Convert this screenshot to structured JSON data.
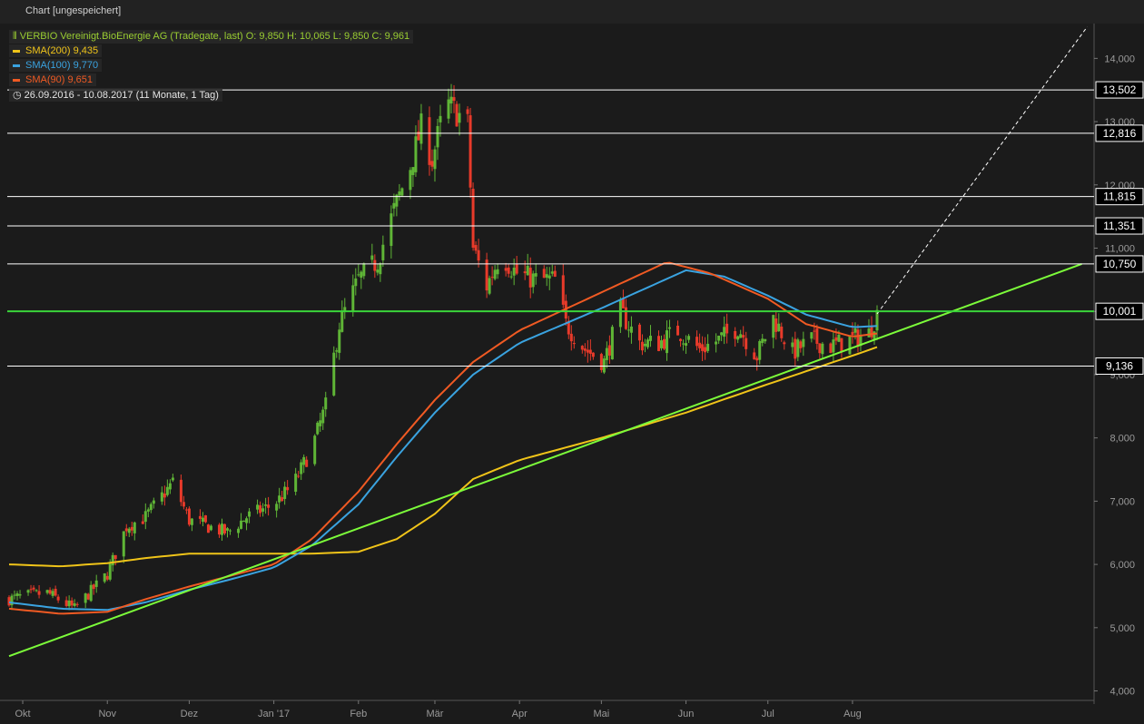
{
  "window": {
    "title": "Chart [ungespeichert]"
  },
  "legend": {
    "main": "VERBIO Vereinigt.BioEnergie AG (Tradegate, last)  O: 9,850  H: 10,065  L: 9,850  C: 9,961",
    "main_color": "#9acd32",
    "sma200": "SMA(200)  9,435",
    "sma100": "SMA(100)  9,770",
    "sma90": "SMA(90)  9,651",
    "range": "26.09.2016 - 10.08.2017   (11 Monate, 1 Tag)",
    "clock_icon": "clock-icon"
  },
  "chart_data": {
    "type": "candlestick",
    "title": "VERBIO Vereinigt.BioEnergie AG (Tradegate, last)",
    "period": "26.09.2016 - 10.08.2017",
    "ylim": [
      3.85,
      14.55
    ],
    "x_labels": [
      "Okt",
      "Nov",
      "Dez",
      "Jan '17",
      "Feb",
      "Mär",
      "Apr",
      "Mai",
      "Jun",
      "Jul",
      "Aug"
    ],
    "y_labels": [
      "4,000",
      "5,000",
      "6,000",
      "7,000",
      "8,000",
      "9,000",
      "10,000",
      "11,000",
      "12,000",
      "13,000",
      "14,000"
    ],
    "y_ticks": [
      4,
      5,
      6,
      7,
      8,
      9,
      10,
      11,
      12,
      13,
      14
    ],
    "colors": {
      "up": "#5fb536",
      "down": "#e83a2a",
      "sma200": "#f0c419",
      "sma100": "#3aa3e0",
      "sma90": "#f05a23",
      "trend": "#7cfc3a",
      "support": "#3ad53a",
      "level": "#ffffff"
    },
    "horizontal_levels": [
      {
        "value": 13.502,
        "label": "13,502",
        "color": "#ffffff"
      },
      {
        "value": 12.816,
        "label": "12,816",
        "color": "#ffffff"
      },
      {
        "value": 11.815,
        "label": "11,815",
        "color": "#ffffff"
      },
      {
        "value": 11.351,
        "label": "11,351",
        "color": "#ffffff"
      },
      {
        "value": 10.75,
        "label": "10,750",
        "color": "#ffffff"
      },
      {
        "value": 10.001,
        "label": "10,001",
        "color": "#3ad53a"
      },
      {
        "value": 9.136,
        "label": "9,136",
        "color": "#ffffff"
      }
    ],
    "trendline": {
      "start": [
        "26.09.2016",
        4.55
      ],
      "end": [
        "10.08.2017",
        9.5
      ],
      "extends_to": [
        "24.10.2017",
        10.75
      ]
    },
    "projection": {
      "start": [
        "10.08.2017",
        9.96
      ],
      "end": [
        "26.10.2017",
        14.5
      ]
    },
    "price_anchors": [
      [
        "26.09.2016",
        5.45
      ],
      [
        "01.10.2016",
        5.5
      ],
      [
        "10.10.2016",
        5.55
      ],
      [
        "20.10.2016",
        5.3
      ],
      [
        "01.11.2016",
        5.85
      ],
      [
        "08.11.2016",
        6.6
      ],
      [
        "15.11.2016",
        6.75
      ],
      [
        "25.11.2016",
        7.3
      ],
      [
        "01.12.2016",
        6.7
      ],
      [
        "08.12.2016",
        6.6
      ],
      [
        "15.12.2016",
        6.5
      ],
      [
        "22.12.2016",
        6.75
      ],
      [
        "01.01.2017",
        6.95
      ],
      [
        "08.01.2017",
        7.25
      ],
      [
        "15.01.2017",
        7.85
      ],
      [
        "20.01.2017",
        8.5
      ],
      [
        "25.01.2017",
        9.8
      ],
      [
        "01.02.2017",
        10.5
      ],
      [
        "08.02.2017",
        10.8
      ],
      [
        "14.02.2017",
        11.6
      ],
      [
        "20.02.2017",
        12.3
      ],
      [
        "24.02.2017",
        12.9
      ],
      [
        "28.02.2017",
        12.4
      ],
      [
        "05.03.2017",
        13.3
      ],
      [
        "10.03.2017",
        13.1
      ],
      [
        "13.03.2017",
        12.95
      ],
      [
        "15.03.2017",
        11.0
      ],
      [
        "20.03.2017",
        10.4
      ],
      [
        "25.03.2017",
        10.9
      ],
      [
        "31.03.2017",
        10.6
      ],
      [
        "07.04.2017",
        10.5
      ],
      [
        "14.04.2017",
        10.5
      ],
      [
        "18.04.2017",
        9.8
      ],
      [
        "25.04.2017",
        9.4
      ],
      [
        "02.05.2017",
        9.2
      ],
      [
        "08.05.2017",
        10.0
      ],
      [
        "15.05.2017",
        9.5
      ],
      [
        "22.05.2017",
        9.5
      ],
      [
        "29.05.2017",
        9.7
      ],
      [
        "06.06.2017",
        9.4
      ],
      [
        "13.06.2017",
        9.55
      ],
      [
        "20.06.2017",
        9.75
      ],
      [
        "27.06.2017",
        9.3
      ],
      [
        "03.07.2017",
        9.9
      ],
      [
        "10.07.2017",
        9.35
      ],
      [
        "17.07.2017",
        9.55
      ],
      [
        "24.07.2017",
        9.45
      ],
      [
        "31.07.2017",
        9.55
      ],
      [
        "07.08.2017",
        9.65
      ],
      [
        "10.08.2017",
        9.96
      ]
    ],
    "sma200_anchors": [
      [
        "26.09.2016",
        6.0
      ],
      [
        "15.10.2016",
        5.97
      ],
      [
        "01.11.2016",
        6.02
      ],
      [
        "15.11.2016",
        6.1
      ],
      [
        "01.12.2016",
        6.17
      ],
      [
        "15.01.2017",
        6.17
      ],
      [
        "01.02.2017",
        6.2
      ],
      [
        "15.02.2017",
        6.4
      ],
      [
        "01.03.2017",
        6.8
      ],
      [
        "15.03.2017",
        7.35
      ],
      [
        "01.04.2017",
        7.65
      ],
      [
        "01.05.2017",
        8.0
      ],
      [
        "01.06.2017",
        8.4
      ],
      [
        "01.07.2017",
        8.85
      ],
      [
        "01.08.2017",
        9.3
      ],
      [
        "10.08.2017",
        9.435
      ]
    ],
    "sma100_anchors": [
      [
        "26.09.2016",
        5.4
      ],
      [
        "15.10.2016",
        5.3
      ],
      [
        "01.11.2016",
        5.28
      ],
      [
        "15.11.2016",
        5.4
      ],
      [
        "01.12.2016",
        5.6
      ],
      [
        "15.12.2016",
        5.75
      ],
      [
        "01.01.2017",
        5.95
      ],
      [
        "15.01.2017",
        6.3
      ],
      [
        "01.02.2017",
        6.95
      ],
      [
        "15.02.2017",
        7.7
      ],
      [
        "01.03.2017",
        8.4
      ],
      [
        "15.03.2017",
        9.0
      ],
      [
        "01.04.2017",
        9.5
      ],
      [
        "01.05.2017",
        10.05
      ],
      [
        "01.06.2017",
        10.65
      ],
      [
        "15.06.2017",
        10.55
      ],
      [
        "01.07.2017",
        10.25
      ],
      [
        "15.07.2017",
        9.95
      ],
      [
        "01.08.2017",
        9.75
      ],
      [
        "10.08.2017",
        9.77
      ]
    ],
    "sma90_anchors": [
      [
        "26.09.2016",
        5.3
      ],
      [
        "15.10.2016",
        5.22
      ],
      [
        "01.11.2016",
        5.25
      ],
      [
        "15.11.2016",
        5.45
      ],
      [
        "01.12.2016",
        5.65
      ],
      [
        "01.01.2017",
        6.0
      ],
      [
        "15.01.2017",
        6.4
      ],
      [
        "01.02.2017",
        7.15
      ],
      [
        "15.02.2017",
        7.9
      ],
      [
        "01.03.2017",
        8.6
      ],
      [
        "15.03.2017",
        9.2
      ],
      [
        "01.04.2017",
        9.7
      ],
      [
        "01.05.2017",
        10.3
      ],
      [
        "25.05.2017",
        10.78
      ],
      [
        "10.06.2017",
        10.6
      ],
      [
        "01.07.2017",
        10.2
      ],
      [
        "15.07.2017",
        9.8
      ],
      [
        "01.08.2017",
        9.6
      ],
      [
        "10.08.2017",
        9.651
      ]
    ]
  }
}
